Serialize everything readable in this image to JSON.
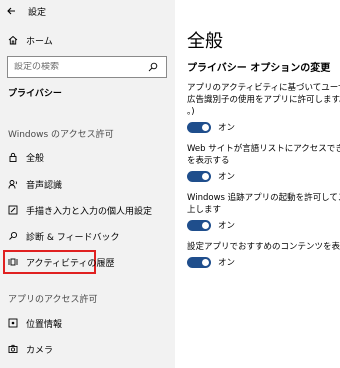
{
  "window": {
    "title": "設定"
  },
  "sidebar": {
    "home_label": "ホーム",
    "search_placeholder": "設定の検索",
    "breadcrumb": "プライバシー",
    "windows_section": "Windows のアクセス許可",
    "windows_items": [
      {
        "label": "全般",
        "icon": "lock-icon"
      },
      {
        "label": "音声認識",
        "icon": "speech-icon"
      },
      {
        "label": "手描き入力と入力の個人用設定",
        "icon": "pen-icon"
      },
      {
        "label": "診断 & フィードバック",
        "icon": "feedback-icon"
      },
      {
        "label": "アクティビティの履歴",
        "icon": "activity-icon",
        "selected": true
      }
    ],
    "app_section": "アプリのアクセス許可",
    "app_items": [
      {
        "label": "位置情報",
        "icon": "location-icon"
      },
      {
        "label": "カメラ",
        "icon": "camera-icon"
      }
    ]
  },
  "main": {
    "title": "全般",
    "subtitle": "プライバシー オプションの変更",
    "settings": [
      {
        "lines": [
          "アプリのアクティビティに基づいてユーザーに合わせ",
          "広告識別子の使用をアプリに許可します。(オフに",
          "。)"
        ],
        "toggle_label": "オン",
        "state": "on"
      },
      {
        "lines": [
          "Web サイトが言語リストにアクセスできるようにし",
          "を表示する"
        ],
        "toggle_label": "オン",
        "state": "on"
      },
      {
        "lines": [
          "Windows 追跡アプリの起動を許可してスタート画",
          "上します"
        ],
        "toggle_label": "オン",
        "state": "on"
      },
      {
        "lines": [
          "設定アプリでおすすめのコンテンツを表示する"
        ],
        "toggle_label": "オン",
        "state": "on"
      }
    ]
  },
  "colors": {
    "sidebar_bg": "#f2f2f2",
    "toggle_on": "#1f4e8c",
    "highlight_border": "#e02020"
  }
}
